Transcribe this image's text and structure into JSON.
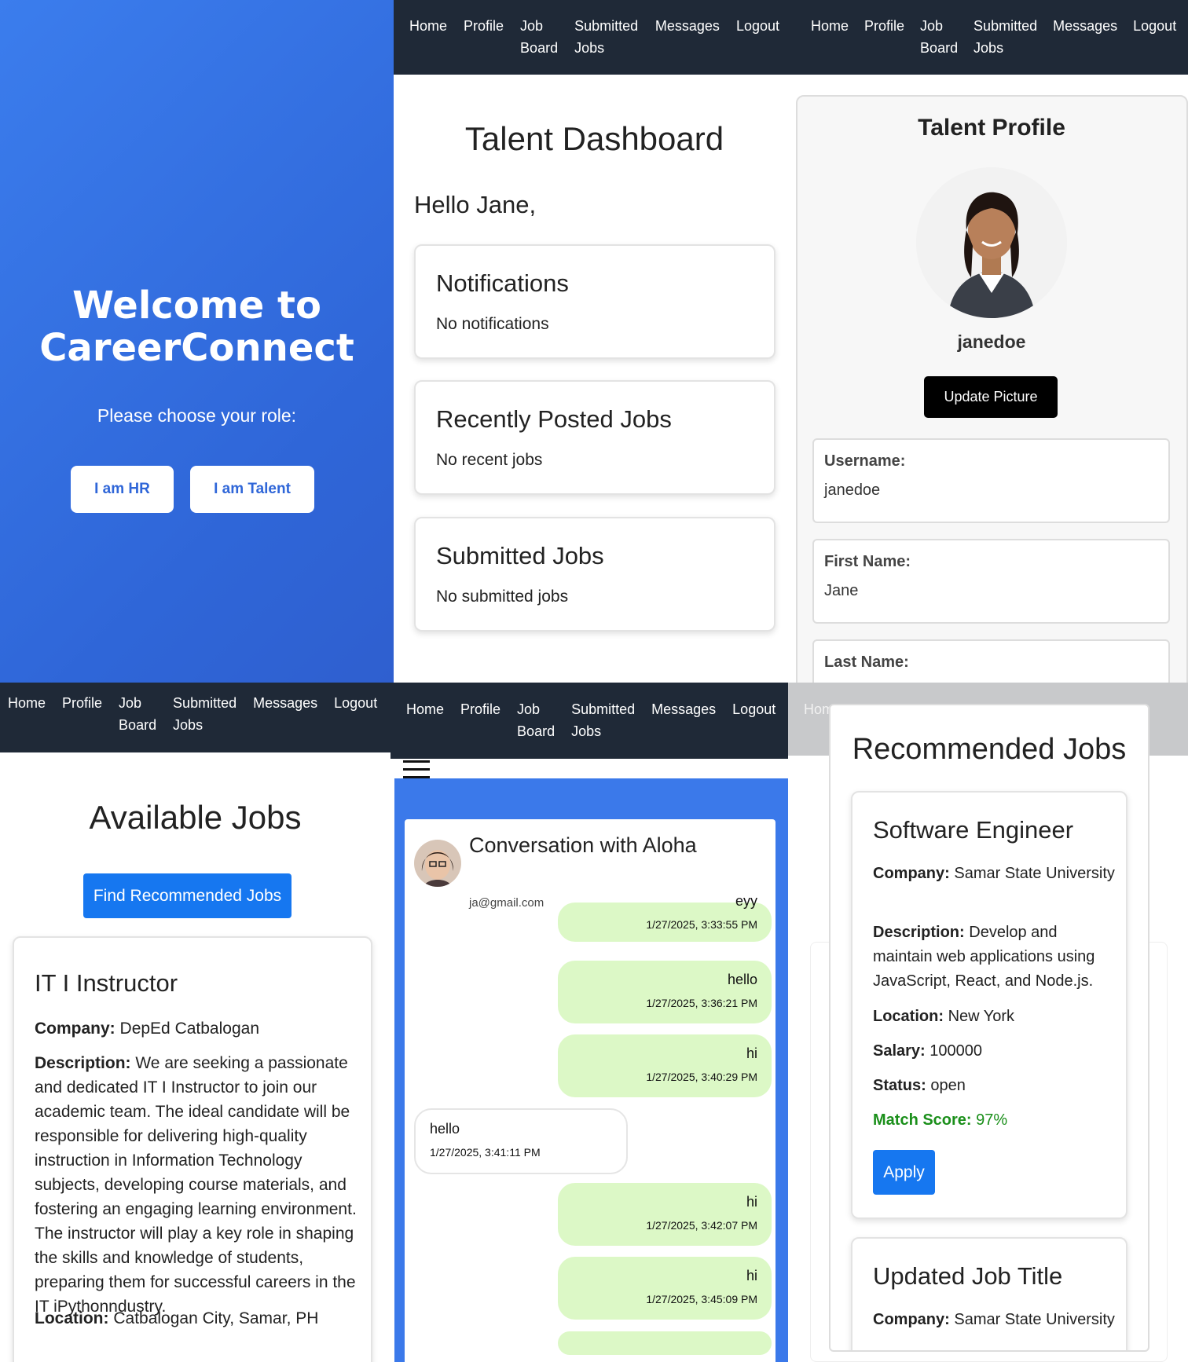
{
  "nav": [
    "Home",
    "Profile",
    "Job Board",
    "Submitted Jobs",
    "Messages",
    "Logout"
  ],
  "welcome": {
    "title": "Welcome to CareerConnect",
    "subtitle": "Please choose your role:",
    "hr_button": "I am HR",
    "talent_button": "I am Talent"
  },
  "dashboard": {
    "title": "Talent Dashboard",
    "greeting": "Hello Jane,",
    "cards": [
      {
        "title": "Notifications",
        "text": "No notifications"
      },
      {
        "title": "Recently Posted Jobs",
        "text": "No recent jobs"
      },
      {
        "title": "Submitted Jobs",
        "text": "No submitted jobs"
      }
    ]
  },
  "profile": {
    "title": "Talent Profile",
    "username": "janedoe",
    "update_button": "Update Picture",
    "fields": [
      {
        "label": "Username:",
        "value": "janedoe"
      },
      {
        "label": "First Name:",
        "value": "Jane"
      },
      {
        "label": "Last Name:",
        "value": ""
      }
    ]
  },
  "jobs": {
    "title": "Available Jobs",
    "find_button": "Find Recommended Jobs",
    "job": {
      "title": "IT I Instructor",
      "company_label": "Company:",
      "company": "DepEd Catbalogan",
      "description_label": "Description:",
      "description": "We are seeking a passionate and dedicated IT I Instructor to join our academic team. The ideal candidate will be responsible for delivering high-quality instruction in Information Technology subjects, developing course materials, and fostering an engaging learning environment. The instructor will play a key role in shaping the skills and knowledge of students, preparing them for successful careers in the IT iPythonndustry.",
      "location_label": "Location:",
      "location": "Catbalogan City, Samar, PH"
    }
  },
  "chat": {
    "title": "Conversation with Aloha",
    "email": "ja@gmail.com",
    "messages": [
      {
        "text": "eyy",
        "time": "1/27/2025, 3:33:55 PM",
        "dir": "out"
      },
      {
        "text": "hello",
        "time": "1/27/2025, 3:36:21 PM",
        "dir": "out"
      },
      {
        "text": "hi",
        "time": "1/27/2025, 3:40:29 PM",
        "dir": "out"
      },
      {
        "text": "hello",
        "time": "1/27/2025, 3:41:11 PM",
        "dir": "in"
      },
      {
        "text": "hi",
        "time": "1/27/2025, 3:42:07 PM",
        "dir": "out"
      },
      {
        "text": "hi",
        "time": "1/27/2025, 3:45:09 PM",
        "dir": "out"
      }
    ]
  },
  "recommended": {
    "title": "Recommended Jobs",
    "jobs": [
      {
        "title": "Software Engineer",
        "company_label": "Company:",
        "company": "Samar State University",
        "description_label": "Description:",
        "description": "Develop and maintain web applications using JavaScript, React, and Node.js.",
        "location_label": "Location:",
        "location": "New York",
        "salary_label": "Salary:",
        "salary": "100000",
        "status_label": "Status:",
        "status": "open",
        "match_label": "Match Score:",
        "match": "97%",
        "apply_button": "Apply"
      },
      {
        "title": "Updated Job Title",
        "company_label": "Company:",
        "company": "Samar State University"
      }
    ],
    "match_color": "#1a8f1a"
  }
}
